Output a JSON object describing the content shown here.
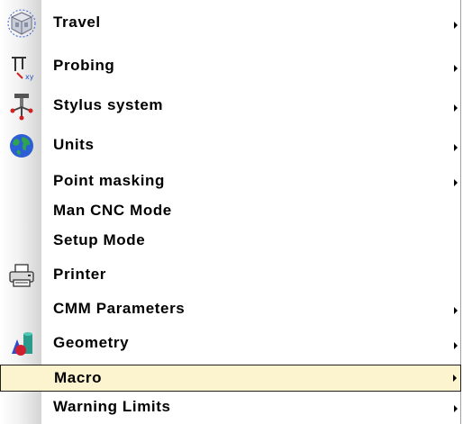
{
  "menu": {
    "items": [
      {
        "label": "Travel",
        "icon": "travel-cube-icon",
        "submenu": true
      },
      {
        "label": "Probing",
        "icon": "probing-icon",
        "submenu": true
      },
      {
        "label": "Stylus system",
        "icon": "stylus-system-icon",
        "submenu": true
      },
      {
        "label": "Units",
        "icon": "globe-icon",
        "submenu": true
      },
      {
        "label": "Point masking",
        "icon": "",
        "submenu": true
      },
      {
        "label": "Man CNC Mode",
        "icon": "",
        "submenu": false
      },
      {
        "label": "Setup Mode",
        "icon": "",
        "submenu": false
      },
      {
        "label": "Printer",
        "icon": "printer-icon",
        "submenu": false
      },
      {
        "label": "CMM Parameters",
        "icon": "",
        "submenu": true
      },
      {
        "label": "Geometry",
        "icon": "geometry-shapes-icon",
        "submenu": true
      },
      {
        "label": "Macro",
        "icon": "",
        "submenu": true,
        "selected": true
      },
      {
        "label": "Warning Limits",
        "icon": "",
        "submenu": true
      }
    ]
  },
  "colors": {
    "highlight": "#fcf3cf",
    "highlight_border": "#1f1f1f",
    "text": "#000000"
  }
}
